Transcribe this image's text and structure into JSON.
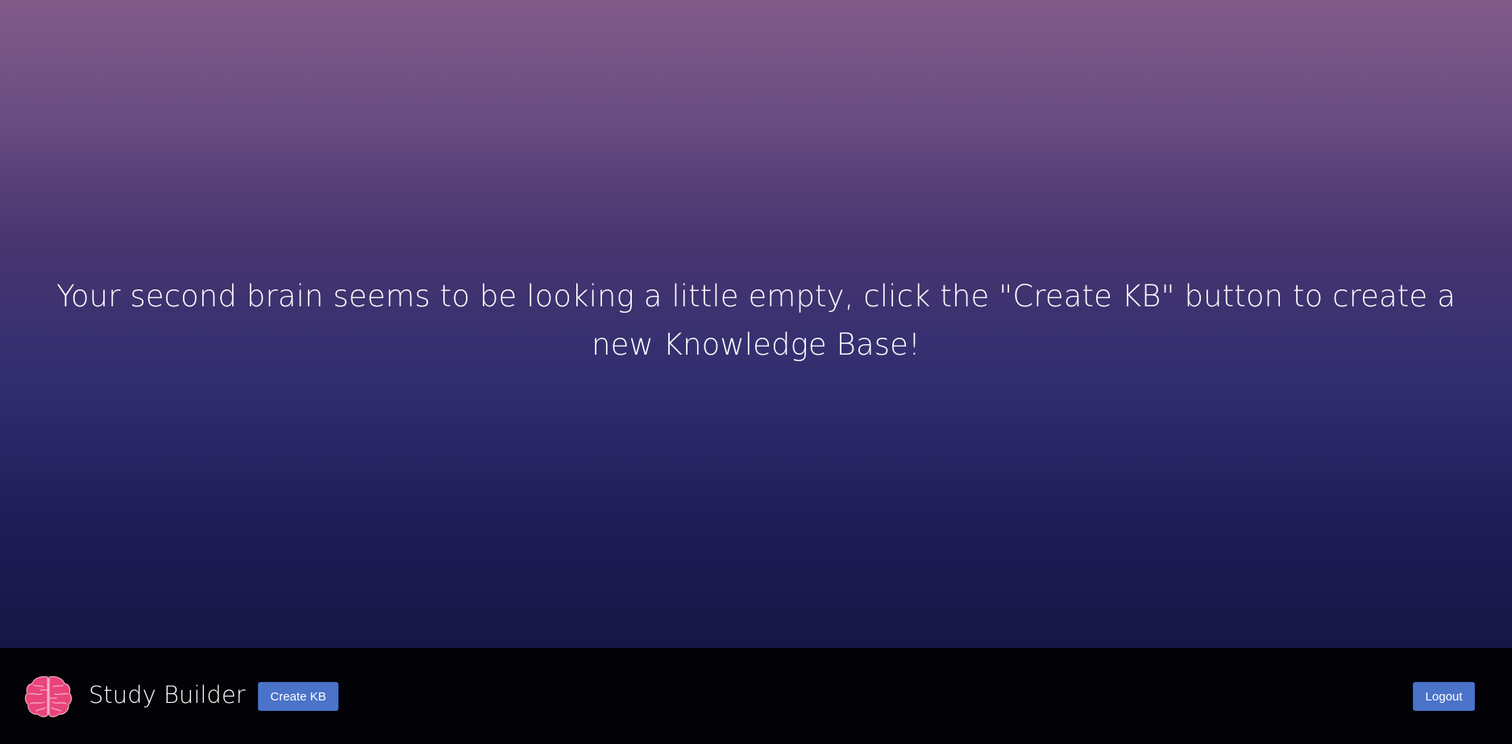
{
  "main": {
    "empty_message": "Your second brain seems to be looking a little empty, click the \"Create KB\" button to create a new Knowledge Base!"
  },
  "footer": {
    "logo_icon": "brain-icon",
    "brand_name": "Study Builder",
    "create_kb_label": "Create KB",
    "logout_label": "Logout"
  },
  "colors": {
    "gradient_top": "#815a88",
    "gradient_bottom": "#161543",
    "footer_bg": "#030307",
    "button_bg": "#4a73c9",
    "logo_pink": "#e8457a"
  }
}
